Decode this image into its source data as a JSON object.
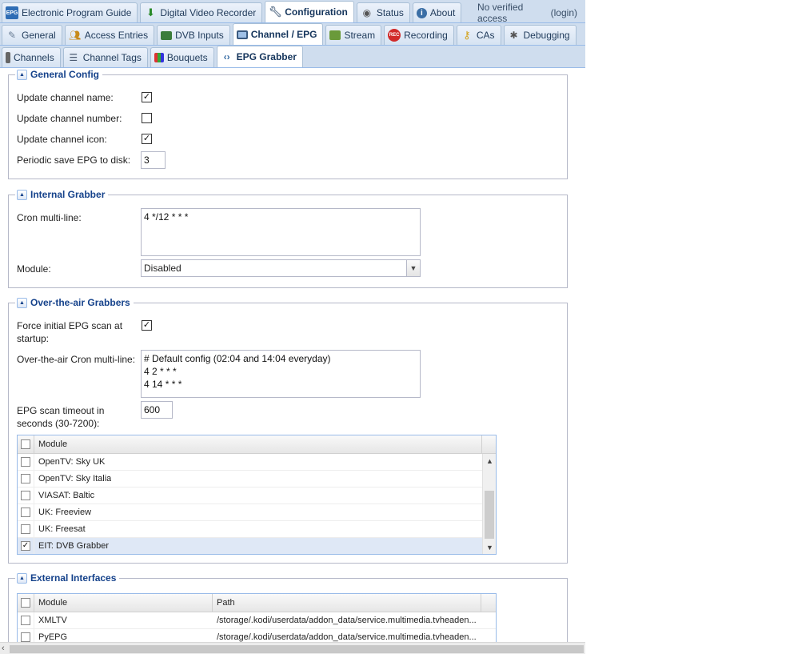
{
  "nav": {
    "top_tabs": [
      {
        "label": "Electronic Program Guide",
        "icon": "epg-icon"
      },
      {
        "label": "Digital Video Recorder",
        "icon": "download-icon"
      },
      {
        "label": "Configuration",
        "icon": "wrench-icon"
      },
      {
        "label": "Status",
        "icon": "eye-icon"
      },
      {
        "label": "About",
        "icon": "info-icon"
      }
    ],
    "access_text": "No verified access",
    "login_label": "(login)",
    "config_tabs": [
      {
        "label": "General",
        "icon": "wrench-icon"
      },
      {
        "label": "Access Entries",
        "icon": "users-icon"
      },
      {
        "label": "DVB Inputs",
        "icon": "card-icon"
      },
      {
        "label": "Channel / EPG",
        "icon": "tv-icon"
      },
      {
        "label": "Stream",
        "icon": "stream-icon"
      },
      {
        "label": "Recording",
        "icon": "rec-icon"
      },
      {
        "label": "CAs",
        "icon": "key-icon"
      },
      {
        "label": "Debugging",
        "icon": "bug-icon"
      }
    ],
    "channel_tabs": [
      {
        "label": "Channels",
        "icon": "remote-icon"
      },
      {
        "label": "Channel Tags",
        "icon": "tree-icon"
      },
      {
        "label": "Bouquets",
        "icon": "grid-icon"
      },
      {
        "label": "EPG Grabber",
        "icon": "share-icon"
      }
    ]
  },
  "general_config": {
    "title": "General Config",
    "update_name_label": "Update channel name:",
    "update_name_checked": "✓",
    "update_number_label": "Update channel number:",
    "update_number_checked": "",
    "update_icon_label": "Update channel icon:",
    "update_icon_checked": "✓",
    "periodic_save_label": "Periodic save EPG to disk:",
    "periodic_save_value": "3"
  },
  "internal_grabber": {
    "title": "Internal Grabber",
    "cron_label": "Cron multi-line:",
    "cron_value": "4 */12 * * *",
    "module_label": "Module:",
    "module_value": "Disabled"
  },
  "ota_grabbers": {
    "title": "Over-the-air Grabbers",
    "force_scan_label_1": "Force initial EPG scan at",
    "force_scan_label_2": "startup:",
    "force_scan_checked": "✓",
    "ota_cron_label": "Over-the-air Cron multi-line:",
    "ota_cron_lines": [
      "# Default config (02:04 and 14:04 everyday)",
      "4 2 * * *",
      "4 14 * * *"
    ],
    "timeout_label_1": "EPG scan timeout in",
    "timeout_label_2": "seconds (30-7200):",
    "timeout_value": "600",
    "grid_header": "Module",
    "modules": [
      {
        "name": "OpenTV: Sky UK",
        "checked": ""
      },
      {
        "name": "OpenTV: Sky Italia",
        "checked": ""
      },
      {
        "name": "VIASAT: Baltic",
        "checked": ""
      },
      {
        "name": "UK: Freeview",
        "checked": ""
      },
      {
        "name": "UK: Freesat",
        "checked": ""
      },
      {
        "name": "EIT: DVB Grabber",
        "checked": "✓"
      }
    ]
  },
  "external_interfaces": {
    "title": "External Interfaces",
    "col_module": "Module",
    "col_path": "Path",
    "rows": [
      {
        "module": "XMLTV",
        "path": "/storage/.kodi/userdata/addon_data/service.multimedia.tvheaden..."
      },
      {
        "module": "PyEPG",
        "path": "/storage/.kodi/userdata/addon_data/service.multimedia.tvheaden..."
      }
    ]
  }
}
